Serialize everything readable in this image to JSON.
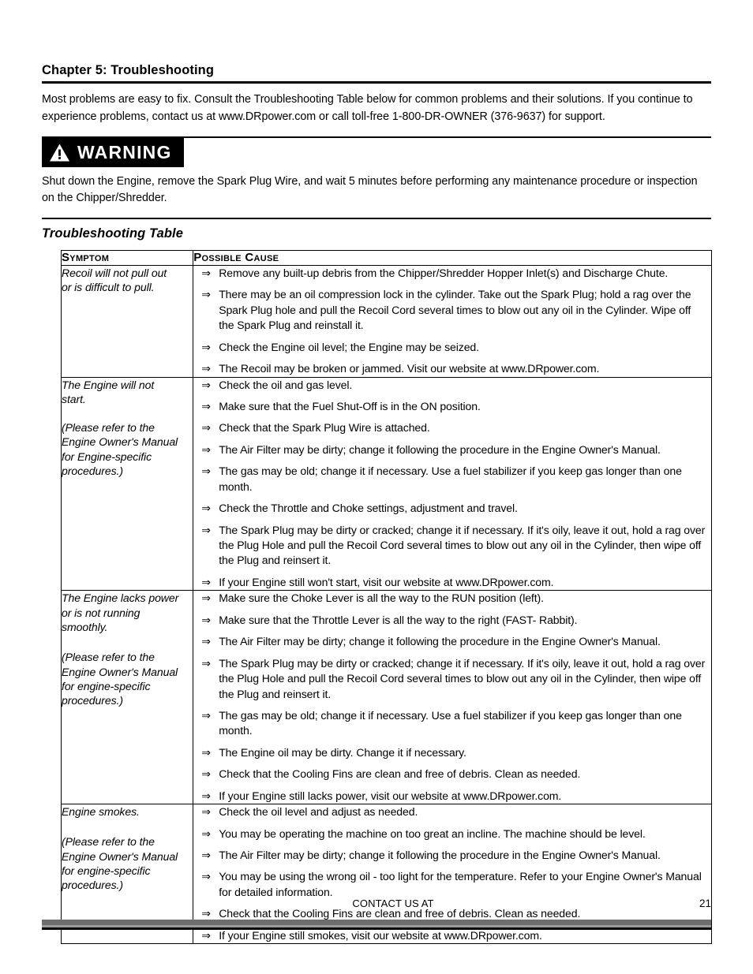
{
  "document": {
    "chapter_title": "Chapter 5: Troubleshooting",
    "intro": "Most problems are easy to fix. Consult the Troubleshooting Table below for common problems and their solutions.  If you continue to experience problems, contact us at www.DRpower.com or call toll-free 1-800-DR-OWNER (376-9637) for support.",
    "section_title": "Troubleshooting Table"
  },
  "warning": {
    "label": "WARNING",
    "icon": "warning-triangle-icon",
    "text": "Shut down the Engine, remove the Spark Plug Wire, and wait 5 minutes before performing any maintenance procedure or inspection on the Chipper/Shredder.",
    "background_color": "#000000",
    "text_color": "#ffffff"
  },
  "table": {
    "headers": {
      "symptom": "Symptom",
      "possible_cause": "Possible Cause"
    },
    "bullet_glyph": "⇒",
    "rows": [
      {
        "symptom_lines": [
          "Recoil will not pull out",
          "or is difficult to pull."
        ],
        "symptom_note": [],
        "causes": [
          "Remove any built-up debris from the Chipper/Shredder Hopper Inlet(s) and Discharge Chute.",
          "There may be an oil compression lock in the cylinder.  Take out the Spark Plug; hold a rag over the Spark Plug hole and pull the Recoil Cord several times to blow out any oil in the Cylinder.  Wipe off the Spark Plug and reinstall it.",
          "Check the Engine oil level; the Engine may be seized.",
          "The Recoil may be broken or jammed.  Visit our website at www.DRpower.com."
        ]
      },
      {
        "symptom_lines": [
          "The Engine will not",
          "start."
        ],
        "symptom_note": [
          "(Please refer to the",
          "Engine Owner's Manual",
          "for Engine-specific",
          "procedures.)"
        ],
        "causes": [
          "Check the oil and gas level.",
          "Make sure that the Fuel Shut-Off is in the ON position.",
          "Check that the Spark Plug Wire is attached.",
          "The Air Filter may be dirty; change it following the procedure in the Engine Owner's Manual.",
          "The gas may be old; change it if necessary.  Use a fuel stabilizer if you keep gas longer than one month.",
          "Check the Throttle and Choke settings, adjustment and travel.",
          "The Spark Plug may be dirty or cracked; change it if necessary.  If it's oily, leave it out, hold a rag over the Plug Hole and pull the Recoil Cord several times to blow out any oil in the Cylinder, then wipe off the Plug and reinsert it.",
          "If your Engine still won't start, visit our website at www.DRpower.com."
        ]
      },
      {
        "symptom_lines": [
          "The Engine lacks power",
          "or is not running",
          "smoothly."
        ],
        "symptom_note": [
          "(Please refer to the",
          "Engine Owner's Manual",
          "for engine-specific",
          "procedures.)"
        ],
        "causes": [
          "Make sure the Choke Lever is all the way to the RUN position (left).",
          "Make sure that the Throttle Lever is all the way to the right (FAST- Rabbit).",
          "The Air Filter may be dirty; change it following the procedure in the Engine Owner's Manual.",
          "The Spark Plug may be dirty or cracked; change it if necessary.  If it's oily, leave it out, hold a rag over the Plug Hole and pull the Recoil Cord several times to blow out any oil in the Cylinder, then wipe off the Plug and reinsert it.",
          "The gas may be old; change it if necessary.  Use a fuel stabilizer if you keep gas longer than one month.",
          "The Engine oil may be dirty.  Change it if necessary.",
          "Check that the Cooling Fins are clean and free of debris. Clean as needed.",
          "If your Engine still lacks power, visit our website at www.DRpower.com."
        ]
      },
      {
        "symptom_lines": [
          "Engine smokes."
        ],
        "symptom_note": [
          "(Please refer to the",
          "Engine Owner's Manual",
          "for engine-specific",
          "procedures.)"
        ],
        "causes": [
          "Check the oil level and adjust as needed.",
          "You may be operating the machine on too great an incline.  The machine should be level.",
          "The Air Filter may be dirty; change it following the procedure in the Engine Owner's Manual.",
          "You may be using the wrong oil - too light for the temperature.  Refer to your Engine Owner's Manual for detailed information.",
          "Check that the Cooling Fins are clean and free of debris. Clean as needed.",
          "If your Engine still smokes, visit our website at www.DRpower.com."
        ]
      }
    ]
  },
  "footer": {
    "contact_text": "CONTACT US AT",
    "page_number": "21",
    "bar_colors": {
      "dark_gray": "#6e6e6e",
      "light_gray": "#9d9d9d",
      "black": "#000000"
    }
  }
}
